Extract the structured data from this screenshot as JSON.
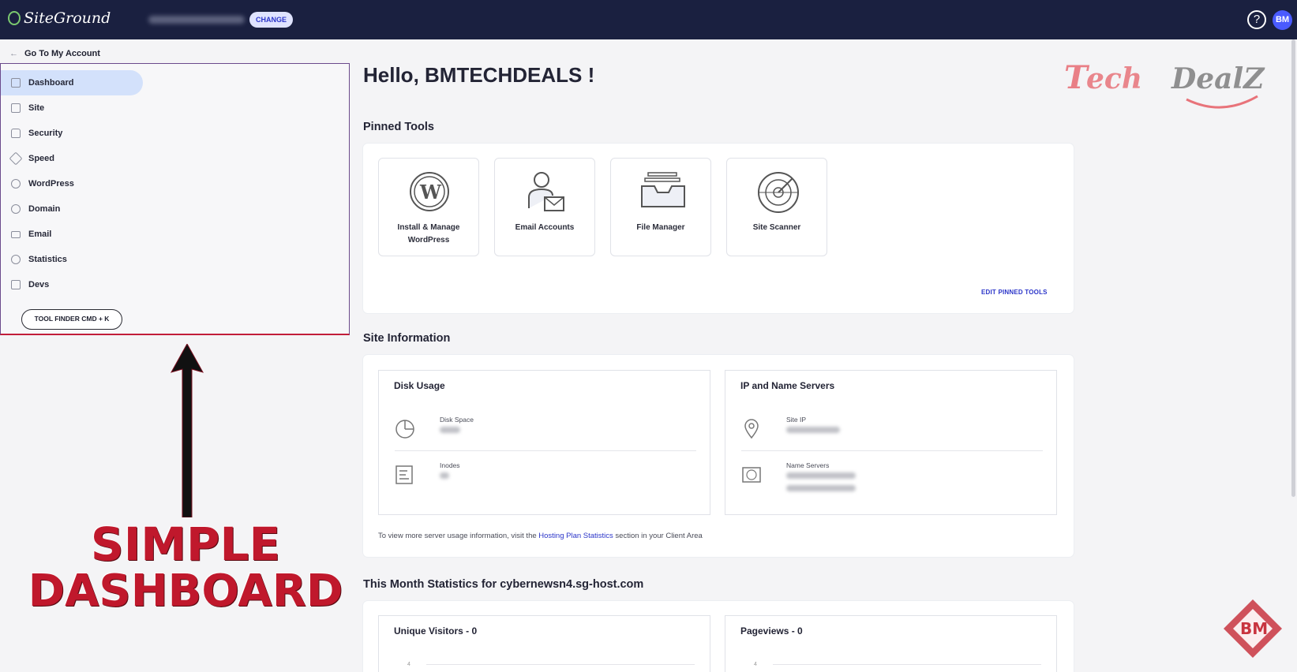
{
  "header": {
    "brand": "SiteGround",
    "change_label": "CHANGE",
    "help_label": "?",
    "avatar_initials": "BM"
  },
  "sidebar": {
    "back_label": "Go To My Account",
    "items": [
      {
        "label": "Dashboard",
        "icon": "dashboard-icon",
        "active": true
      },
      {
        "label": "Site",
        "icon": "site-icon"
      },
      {
        "label": "Security",
        "icon": "lock-icon"
      },
      {
        "label": "Speed",
        "icon": "rocket-icon"
      },
      {
        "label": "WordPress",
        "icon": "wordpress-icon"
      },
      {
        "label": "Domain",
        "icon": "globe-icon"
      },
      {
        "label": "Email",
        "icon": "mail-icon"
      },
      {
        "label": "Statistics",
        "icon": "pie-chart-icon"
      },
      {
        "label": "Devs",
        "icon": "code-icon"
      }
    ],
    "tool_finder_label": "TOOL FINDER CMD + K"
  },
  "overlay": {
    "caption_line1": "SIMPLE",
    "caption_line2": "DASHBOARD",
    "watermark": "Tech DealZ",
    "corner_logo": "BM"
  },
  "main": {
    "greeting": "Hello, BMTECHDEALS !",
    "pinned_title": "Pinned Tools",
    "tools": [
      {
        "label": "Install & Manage WordPress",
        "icon": "wordpress-icon"
      },
      {
        "label": "Email Accounts",
        "icon": "email-accounts-icon"
      },
      {
        "label": "File Manager",
        "icon": "file-manager-icon"
      },
      {
        "label": "Site Scanner",
        "icon": "site-scanner-icon"
      }
    ],
    "edit_pinned_label": "EDIT PINNED TOOLS",
    "site_info_title": "Site Information",
    "disk_usage": {
      "title": "Disk Usage",
      "disk_space_label": "Disk Space",
      "inodes_label": "Inodes"
    },
    "ip_servers": {
      "title": "IP and Name Servers",
      "site_ip_label": "Site IP",
      "name_servers_label": "Name Servers"
    },
    "footnote_prefix": "To view more server usage information, visit the ",
    "footnote_link": "Hosting Plan Statistics",
    "footnote_suffix": " section in your Client Area",
    "stats_title": "This Month Statistics for cybernewsn4.sg-host.com",
    "unique_visitors": "Unique Visitors - 0",
    "pageviews": "Pageviews - 0",
    "axis_tick": "4"
  }
}
